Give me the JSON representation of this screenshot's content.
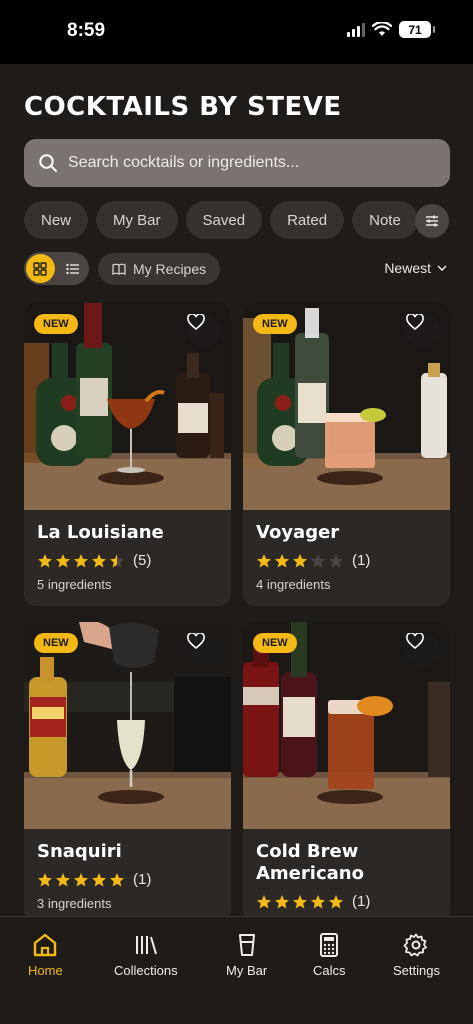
{
  "status": {
    "time": "8:59",
    "battery": "71"
  },
  "app": {
    "title": "COCKTAILS BY STEVE"
  },
  "search": {
    "placeholder": "Search cocktails or ingredients..."
  },
  "filters": {
    "chips": [
      "New",
      "My Bar",
      "Saved",
      "Rated",
      "Note"
    ]
  },
  "toolbar": {
    "my_recipes": "My Recipes",
    "sort": "Newest"
  },
  "colors": {
    "accent": "#f5b915",
    "background": "#1e1b19",
    "card": "#2c2826",
    "chip": "#35312f"
  },
  "cards": [
    {
      "badge": "NEW",
      "name": "La Louisiane",
      "rating": 4.5,
      "rating_count": "(5)",
      "ingredients": "5 ingredients"
    },
    {
      "badge": "NEW",
      "name": "Voyager",
      "rating": 3,
      "rating_count": "(1)",
      "ingredients": "4 ingredients"
    },
    {
      "badge": "NEW",
      "name": "Snaquiri",
      "rating": 5,
      "rating_count": "(1)",
      "ingredients": "3 ingredients"
    },
    {
      "badge": "NEW",
      "name": "Cold Brew Americano",
      "rating": 5,
      "rating_count": "(1)",
      "ingredients": ""
    }
  ],
  "tabs": [
    {
      "label": "Home",
      "icon": "home-icon",
      "active": true
    },
    {
      "label": "Collections",
      "icon": "library-icon"
    },
    {
      "label": "My Bar",
      "icon": "glass-icon"
    },
    {
      "label": "Calcs",
      "icon": "calculator-icon"
    },
    {
      "label": "Settings",
      "icon": "gear-icon"
    }
  ]
}
